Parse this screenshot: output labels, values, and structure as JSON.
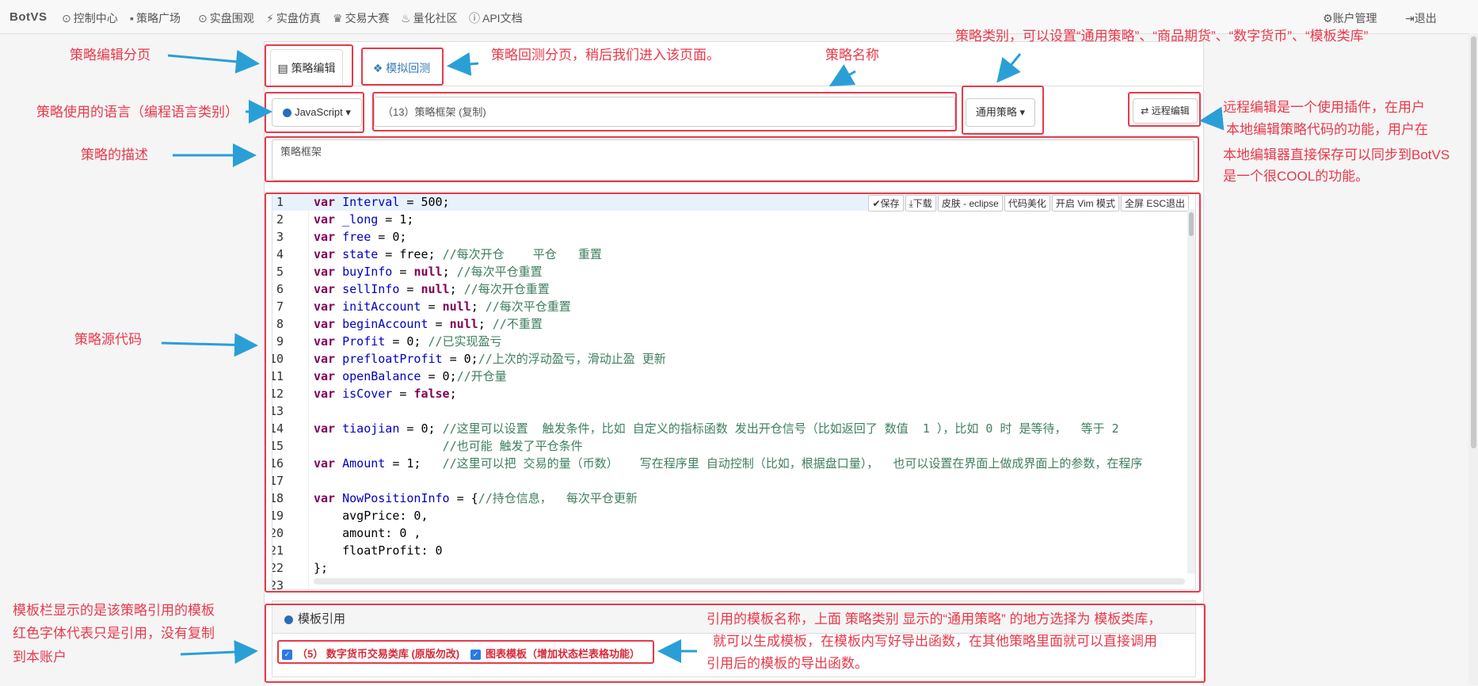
{
  "nav": {
    "brand": "BotVS",
    "items": [
      {
        "icon": "dashboard-icon",
        "glyph": "⊙",
        "label": "控制中心"
      },
      {
        "icon": "cart-icon",
        "glyph": "▪",
        "label": "策略广场"
      },
      {
        "icon": "play-icon",
        "glyph": "⊙",
        "label": "实盘围观"
      },
      {
        "icon": "bolt-icon",
        "glyph": "⚡",
        "label": "实盘仿真"
      },
      {
        "icon": "trophy-icon",
        "glyph": "♛",
        "label": "交易大赛"
      },
      {
        "icon": "fire-icon",
        "glyph": "♨",
        "label": "量化社区"
      },
      {
        "icon": "info-icon",
        "glyph": "ⓘ",
        "label": "API文档"
      }
    ],
    "account": {
      "icon": "gear-icon",
      "glyph": "⚙",
      "label": "账户管理"
    },
    "logout": {
      "icon": "logout-icon",
      "glyph": "⇥",
      "label": "退出"
    }
  },
  "tabs": {
    "edit": {
      "icon": "document-icon",
      "glyph": "▤",
      "label": "策略编辑"
    },
    "backtest": {
      "icon": "cubes-icon",
      "glyph": "❖",
      "label": "模拟回测"
    }
  },
  "form": {
    "language": "JavaScript",
    "name": "（13）策略框架 (复制)",
    "category": "通用策略",
    "remote_edit": "远程编辑",
    "description": "策略框架"
  },
  "editor": {
    "toolbar": [
      "✔保存",
      "⤓下载",
      "皮肤 - eclipse",
      "代码美化",
      "开启 Vim 模式",
      "全屏 ESC退出"
    ],
    "lines": [
      "var Interval = 500;",
      "var _long = 1;",
      "var free = 0;",
      "var state = free; //每次开仓    平仓   重置",
      "var buyInfo = null; //每次平仓重置",
      "var sellInfo = null; //每次开仓重置",
      "var initAccount = null; //每次平仓重置",
      "var beginAccount = null; //不重置",
      "var Profit = 0; //已实现盈亏",
      "var prefloatProfit = 0;//上次的浮动盈亏，滑动止盈 更新",
      "var openBalance = 0;//开仓量",
      "var isCover = false;",
      "",
      "var tiaojian = 0; //这里可以设置  触发条件，比如 自定义的指标函数 发出开仓信号（比如返回了 数值  1 ），比如 0 时 是等待，  等于 2",
      "                  //也可能 触发了平仓条件",
      "var Amount = 1;   //这里可以把 交易的量（币数）   写在程序里 自动控制（比如，根据盘口量），  也可以设置在界面上做成界面上的参数，在程序",
      "",
      "var NowPositionInfo = {//持仓信息，  每次平仓更新",
      "    avgPrice: 0,",
      "    amount: 0 ,",
      "    floatProfit: 0",
      "};",
      ""
    ]
  },
  "templates": {
    "title": "模板引用",
    "items": [
      {
        "label": "（5） 数字货币交易类库 (原版勿改)",
        "color": "#d9283a",
        "checked": true
      },
      {
        "label": "图表模板（增加状态栏表格功能）",
        "color": "#d9283a",
        "checked": true
      }
    ]
  },
  "annotations": {
    "edit_tab": "策略编辑分页",
    "backtest_tab": "策略回测分页，稍后我们进入该页面。",
    "name": "策略名称",
    "category": "策略类别，可以设置“通用策略”、“商品期货”、“数字货币”、“模板类库”",
    "language": "策略使用的语言（编程语言类别）",
    "remote": [
      "远程编辑是一个使用插件，在用户",
      "本地编辑策略代码的功能，用户在",
      "本地编辑器直接保存可以同步到BotVS",
      "是一个很COOL的功能。"
    ],
    "description": "策略的描述",
    "source": "策略源代码",
    "template_bar": [
      "模板栏显示的是该策略引用的模板",
      "红色字体代表只是引用，没有复制",
      "到本账户"
    ],
    "template_name": [
      "引用的模板名称，上面 策略类别 显示的“通用策略” 的地方选择为 模板类库，",
      "就可以生成模板，在模板内写好导出函数，在其他策略里面就可以直接调用",
      "引用后的模板的导出函数。"
    ]
  }
}
